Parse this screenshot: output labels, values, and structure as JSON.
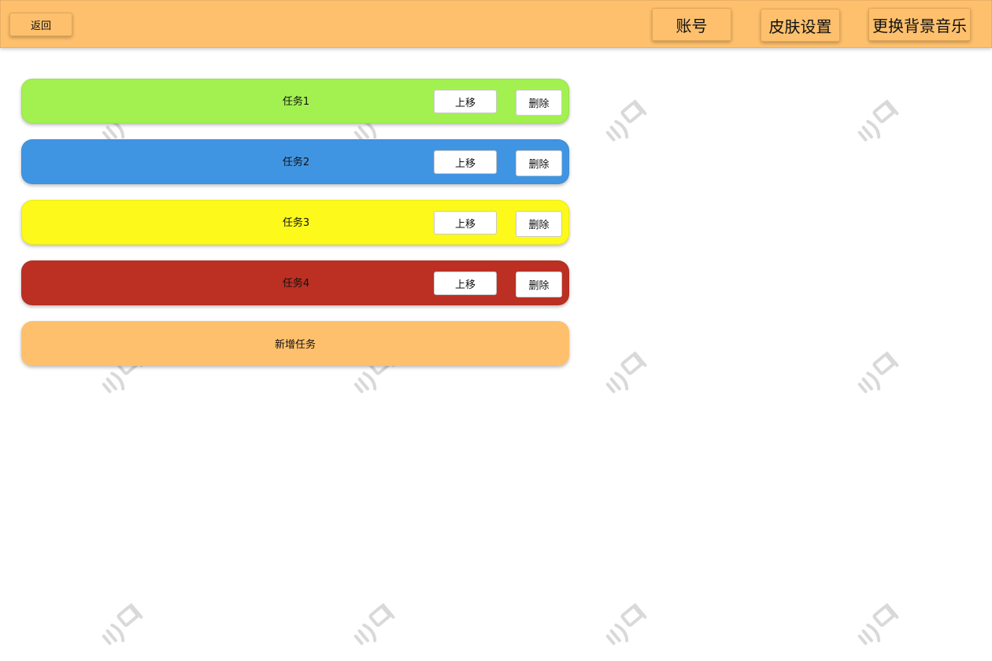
{
  "header": {
    "back_label": "返回",
    "account_label": "账号",
    "skin_label": "皮肤设置",
    "music_label": "更换背景音乐",
    "bg_color": "#fec06c"
  },
  "tasks": [
    {
      "label": "任务1",
      "color": "#a3f150",
      "up_label": "上移",
      "delete_label": "删除"
    },
    {
      "label": "任务2",
      "color": "#4095e3",
      "up_label": "上移",
      "delete_label": "删除"
    },
    {
      "label": "任务3",
      "color": "#fdf91a",
      "up_label": "上移",
      "delete_label": "删除"
    },
    {
      "label": "任务4",
      "color": "#bb3022",
      "up_label": "上移",
      "delete_label": "删除"
    }
  ],
  "add_task": {
    "label": "新增任务",
    "color": "#fec06c"
  },
  "watermark": {
    "icon": "watermark-logo-icon"
  }
}
